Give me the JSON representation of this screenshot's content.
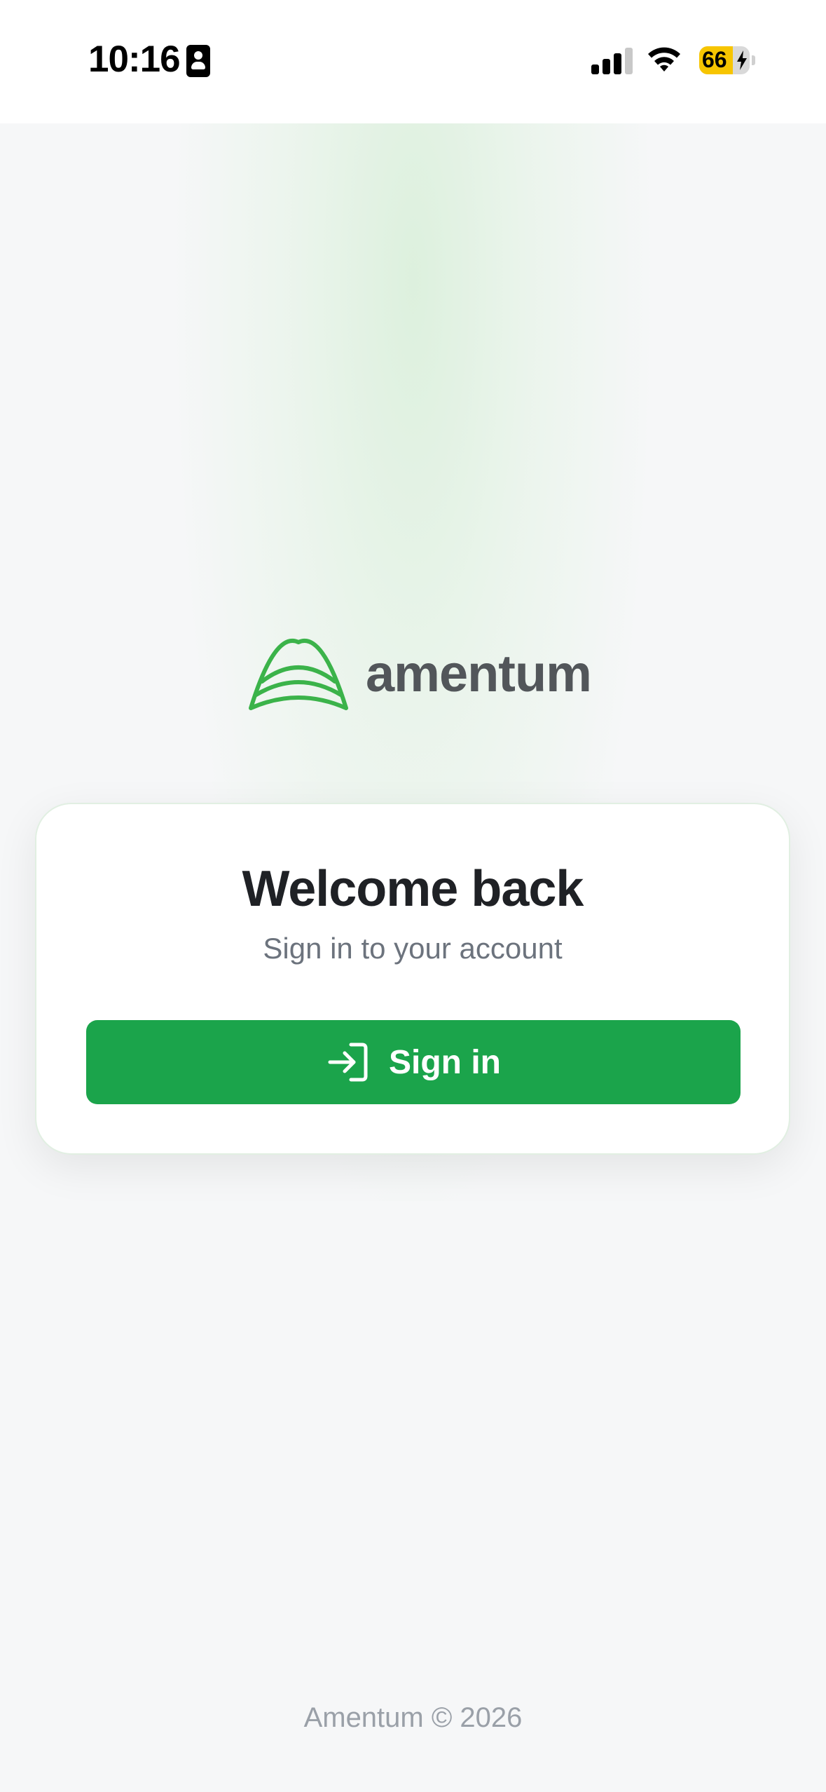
{
  "status_bar": {
    "time": "10:16",
    "battery_percent": "66",
    "battery_level": 0.66,
    "signal_bars_active": 3,
    "icons": [
      "contact-card-icon",
      "cellular-signal-icon",
      "wifi-icon",
      "battery-charging-icon"
    ]
  },
  "brand": {
    "name": "amentum",
    "logo_icon": "amentum-arch-logo",
    "accent_color": "#1ba44b",
    "logo_color": "#3bb34a"
  },
  "login_card": {
    "title": "Welcome back",
    "subtitle": "Sign in to your account",
    "sign_in_button": {
      "label": "Sign in",
      "icon": "login-arrow-icon"
    }
  },
  "footer": {
    "text": "Amentum © 2026"
  }
}
